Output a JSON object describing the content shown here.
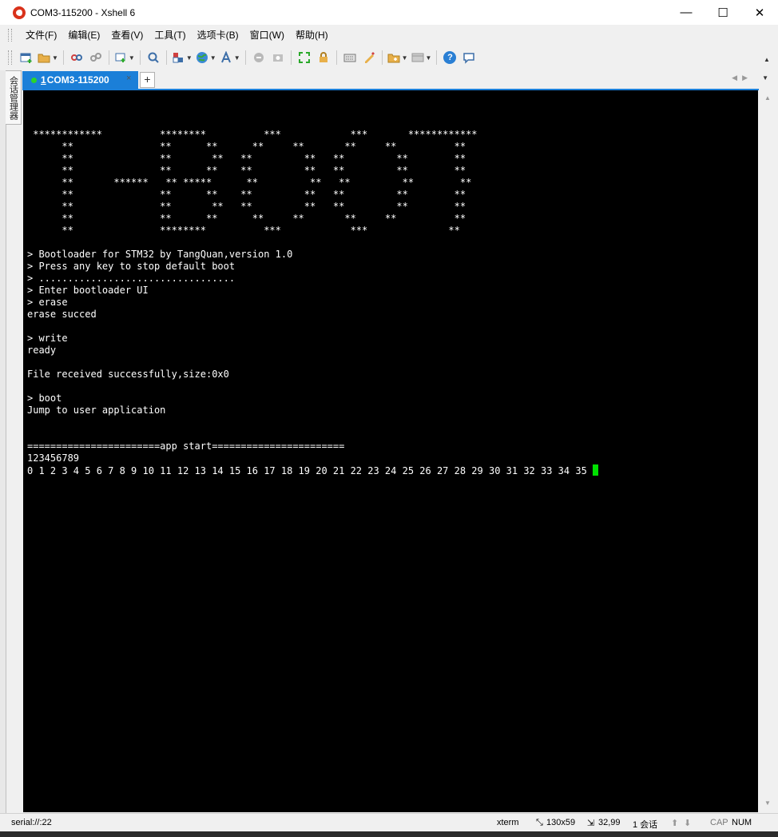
{
  "window": {
    "title": "COM3-115200 - Xshell 6",
    "minimize_glyph": "—",
    "maximize_glyph": "☐",
    "close_glyph": "✕"
  },
  "menu": [
    "文件(F)",
    "编辑(E)",
    "查看(V)",
    "工具(T)",
    "选项卡(B)",
    "窗口(W)",
    "帮助(H)"
  ],
  "toolbar": {
    "icons": [
      "new-session-icon",
      "open-folder-icon",
      "connect-icon",
      "disconnect-icon",
      "reconnect-icon",
      "find-icon",
      "properties-icon",
      "globe-icon",
      "font-icon",
      "transfer-icon",
      "sftp-icon",
      "fullscreen-icon",
      "lock-icon",
      "keyboard-icon",
      "highlight-icon",
      "new-folder-icon",
      "layout-icon",
      "help-icon",
      "chat-icon"
    ]
  },
  "side_panel": {
    "label": "会话管理器"
  },
  "tabs": {
    "active": {
      "number": "1",
      "label": " COM3-115200"
    },
    "close_glyph": "×",
    "add_glyph": "+"
  },
  "terminal": {
    "lines": [
      " ************          ********          ***            ***       ************",
      "      **               **      **      **     **       **     **          **",
      "      **               **       **   **         **   **         **        **",
      "      **               **      **    **         **   **         **        **",
      "      **       ******   ** *****      **         **   **         **        **",
      "      **               **      **    **         **   **         **        **",
      "      **               **       **   **         **   **         **        **",
      "      **               **      **      **     **       **     **          **",
      "      **               ********          ***            ***              **",
      "",
      "> Bootloader for STM32 by TangQuan,version 1.0",
      "> Press any key to stop default boot",
      "> ..................................",
      "> Enter bootloader UI",
      "> erase",
      "erase succed",
      "",
      "> write",
      "ready",
      "",
      "File received successfully,size:0x0",
      "",
      "> boot",
      "Jump to user application",
      "",
      "",
      "=======================app start=======================",
      "123456789"
    ],
    "last_line": "0 1 2 3 4 5 6 7 8 9 10 11 12 13 14 15 16 17 18 19 20 21 22 23 24 25 26 27 28 29 30 31 32 33 34 35 ",
    "background": "#000000",
    "foreground": "#ffffff",
    "cursor_color": "#00e000"
  },
  "status": {
    "connection": "serial://:22",
    "terminal_type": "xterm",
    "size": "130x59",
    "position": "32,99",
    "sessions": "1 会话",
    "caps": "CAP",
    "num": "NUM"
  },
  "colors": {
    "tab_active": "#1b7fd8",
    "tab_dot": "#2bd52b"
  }
}
